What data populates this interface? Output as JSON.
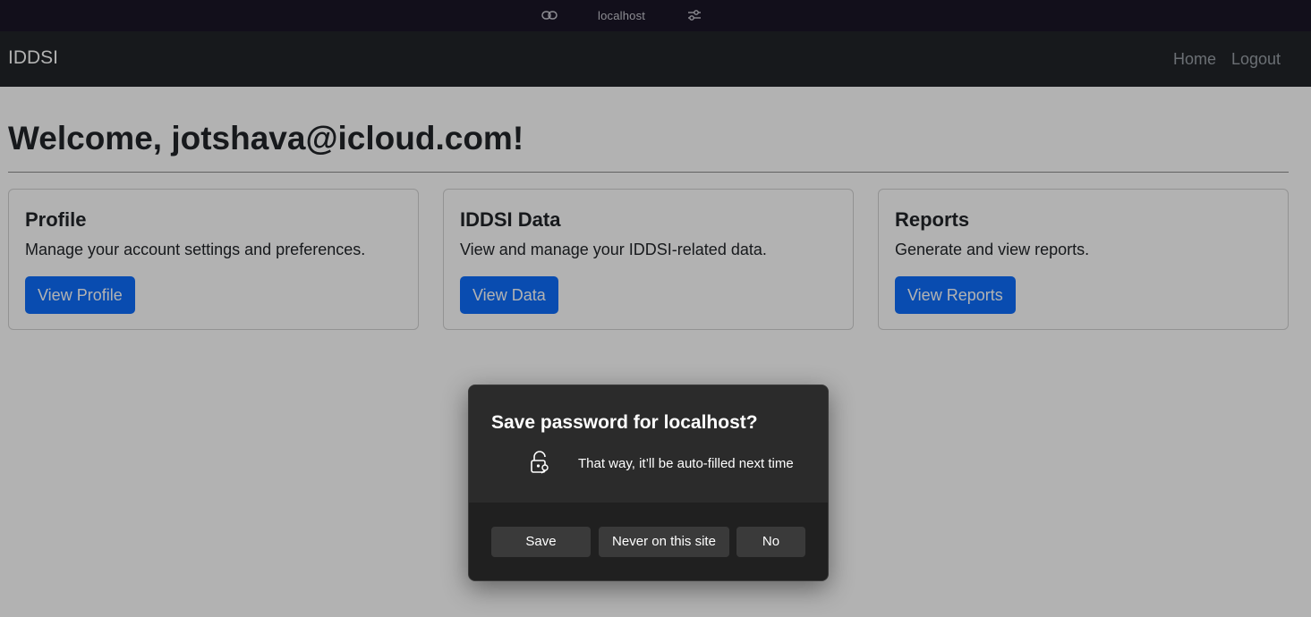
{
  "browser": {
    "url": "localhost",
    "link_icon": "link-icon",
    "settings_icon": "tune-icon"
  },
  "navbar": {
    "brand": "IDDSI",
    "links": [
      "Home",
      "Logout"
    ]
  },
  "main": {
    "welcome": "Welcome, jotshava@icloud.com!",
    "cards": [
      {
        "title": "Profile",
        "text": "Manage your account settings and preferences.",
        "button": "View Profile"
      },
      {
        "title": "IDDSI Data",
        "text": "View and manage your IDDSI-related data.",
        "button": "View Data"
      },
      {
        "title": "Reports",
        "text": "Generate and view reports.",
        "button": "View Reports"
      }
    ]
  },
  "dialog": {
    "title": "Save password for localhost?",
    "icon": "lock-key-icon",
    "message": "That way, it’ll be auto-filled next time",
    "buttons": {
      "save": "Save",
      "never": "Never on this site",
      "no": "No"
    }
  },
  "colors": {
    "navbar_bg": "#212529",
    "primary_button": "#0d6efd",
    "dialog_bg": "#2b2b2b"
  }
}
